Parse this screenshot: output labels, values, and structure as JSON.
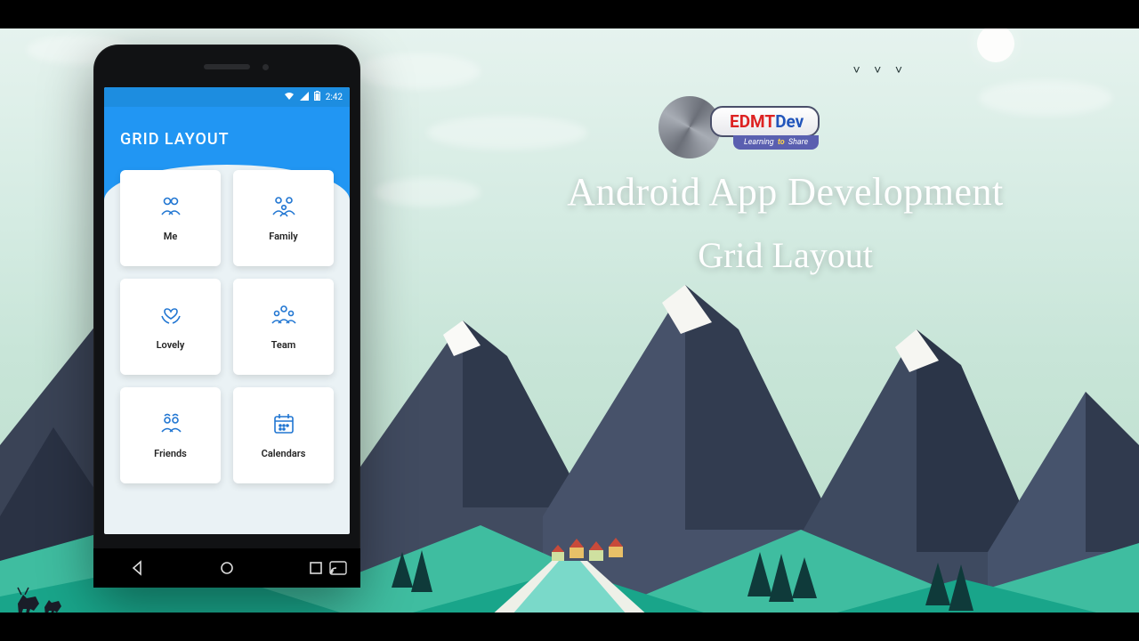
{
  "statusbar": {
    "time": "2:42"
  },
  "header": {
    "title": "GRID LAYOUT"
  },
  "cards": [
    {
      "icon": "me-icon",
      "label": "Me",
      "glyph": "👤"
    },
    {
      "icon": "family-icon",
      "label": "Family",
      "glyph": "👨‍👩‍👧"
    },
    {
      "icon": "lovely-icon",
      "label": "Lovely",
      "glyph": "💙"
    },
    {
      "icon": "team-icon",
      "label": "Team",
      "glyph": "👥"
    },
    {
      "icon": "friends-icon",
      "label": "Friends",
      "glyph": "🗣"
    },
    {
      "icon": "calendars-icon",
      "label": "Calendars",
      "glyph": "📅"
    }
  ],
  "promo": {
    "line1": "Android App Development",
    "line2": "Grid Layout"
  },
  "logo": {
    "brand_plain": "EDMT",
    "brand_accent": "Dev",
    "tagline_pre": "Learning",
    "tagline_mid": "to",
    "tagline_post": "Share"
  }
}
